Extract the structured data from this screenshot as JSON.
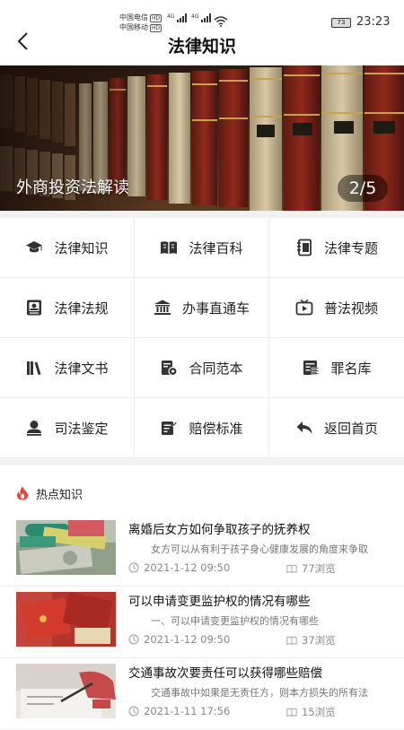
{
  "status": {
    "carrier1": "中国电信",
    "carrier2": "中国移动",
    "hd": "HD",
    "net": "4G",
    "battery": "73",
    "time": "23:23"
  },
  "nav": {
    "title": "法律知识"
  },
  "banner": {
    "caption": "外商投资法解读",
    "pager": "2/5"
  },
  "grid": [
    {
      "label": "法律知识",
      "icon": "graduation-cap-icon"
    },
    {
      "label": "法律百科",
      "icon": "open-book-icon"
    },
    {
      "label": "法律专题",
      "icon": "notebook-icon"
    },
    {
      "label": "法律法规",
      "icon": "law-book-icon"
    },
    {
      "label": "办事直通车",
      "icon": "bank-icon"
    },
    {
      "label": "普法视频",
      "icon": "video-icon"
    },
    {
      "label": "法律文书",
      "icon": "books-icon"
    },
    {
      "label": "合同范本",
      "icon": "contract-icon"
    },
    {
      "label": "罪名库",
      "icon": "list-doc-icon"
    },
    {
      "label": "司法鉴定",
      "icon": "user-icon"
    },
    {
      "label": "赔偿标准",
      "icon": "edit-doc-icon"
    },
    {
      "label": "返回首页",
      "icon": "return-icon"
    }
  ],
  "hot": {
    "title": "热点知识"
  },
  "news": [
    {
      "title": "离婚后女方如何争取孩子的抚养权",
      "summary": "女方可以从有利于孩子身心健康发展的角度来争取",
      "date": "2021-1-12 09:50",
      "views": "77浏览"
    },
    {
      "title": "可以申请变更监护权的情况有哪些",
      "summary": "一、可以申请变更监护权的情况有哪些",
      "date": "2021-1-12 09:50",
      "views": "37浏览"
    },
    {
      "title": "交通事故次要责任可以获得哪些赔偿",
      "summary": "交通事故中如果是无责任方，则本方损失的所有法",
      "date": "2021-1-11 17:56",
      "views": "15浏览"
    }
  ],
  "colors": {
    "icon": "#333333",
    "accent_fire": "#e8453c",
    "divider": "#f2f2f2"
  }
}
